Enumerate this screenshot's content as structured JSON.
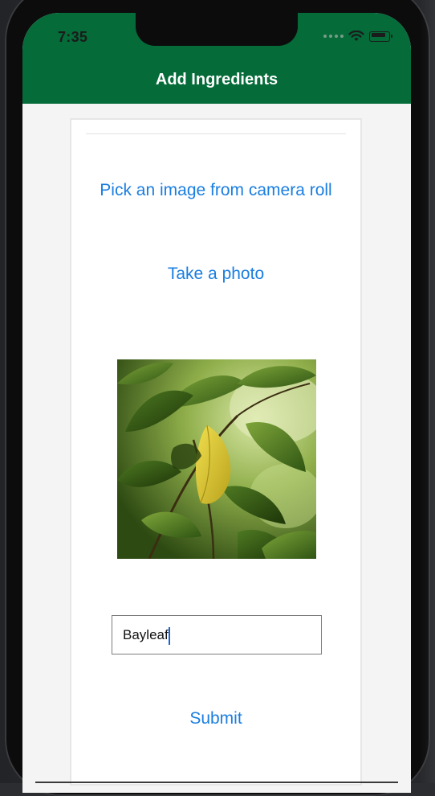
{
  "status_bar": {
    "time": "7:35",
    "icons": [
      "signal-dots-icon",
      "wifi-icon",
      "battery-icon"
    ]
  },
  "nav": {
    "title": "Add Ingredients"
  },
  "actions": {
    "pick_image_label": "Pick an image from camera roll",
    "take_photo_label": "Take a photo",
    "submit_label": "Submit"
  },
  "ingredient_field": {
    "value": "Bayleaf"
  },
  "colors": {
    "header_green": "#046b39",
    "link_blue": "#1a7ee0"
  }
}
